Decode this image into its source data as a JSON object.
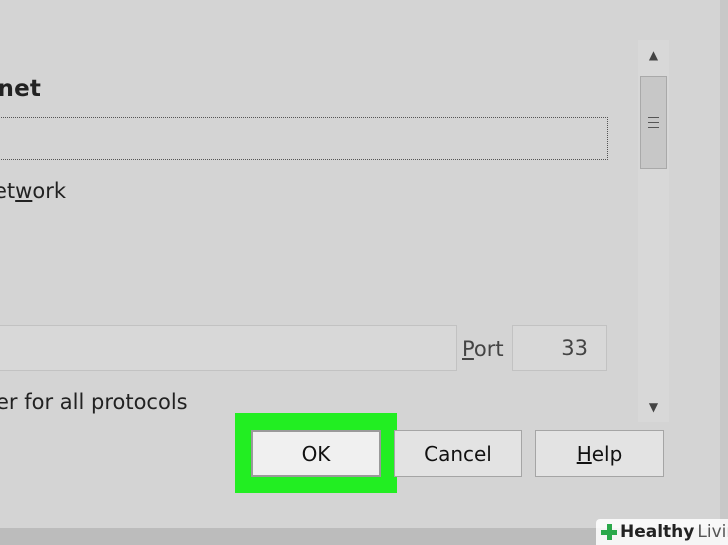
{
  "connection": {
    "heading_fragment": "rnet",
    "network_option": {
      "prefix": "et",
      "underlined": "w",
      "suffix": "ork"
    },
    "port": {
      "label_underlined": "P",
      "label_rest": "ort",
      "value": "33"
    },
    "all_protocols_fragment": "er for all protocols"
  },
  "scrollbar": {
    "up_arrow": "▲",
    "down_arrow": "▼"
  },
  "buttons": {
    "ok": "OK",
    "cancel": "Cancel",
    "help_underlined": "H",
    "help_rest": "elp"
  },
  "highlight": {
    "target": "ok",
    "color": "#22ee22"
  },
  "watermark": {
    "brand_strong": "Healthy",
    "brand_light": "Living"
  }
}
